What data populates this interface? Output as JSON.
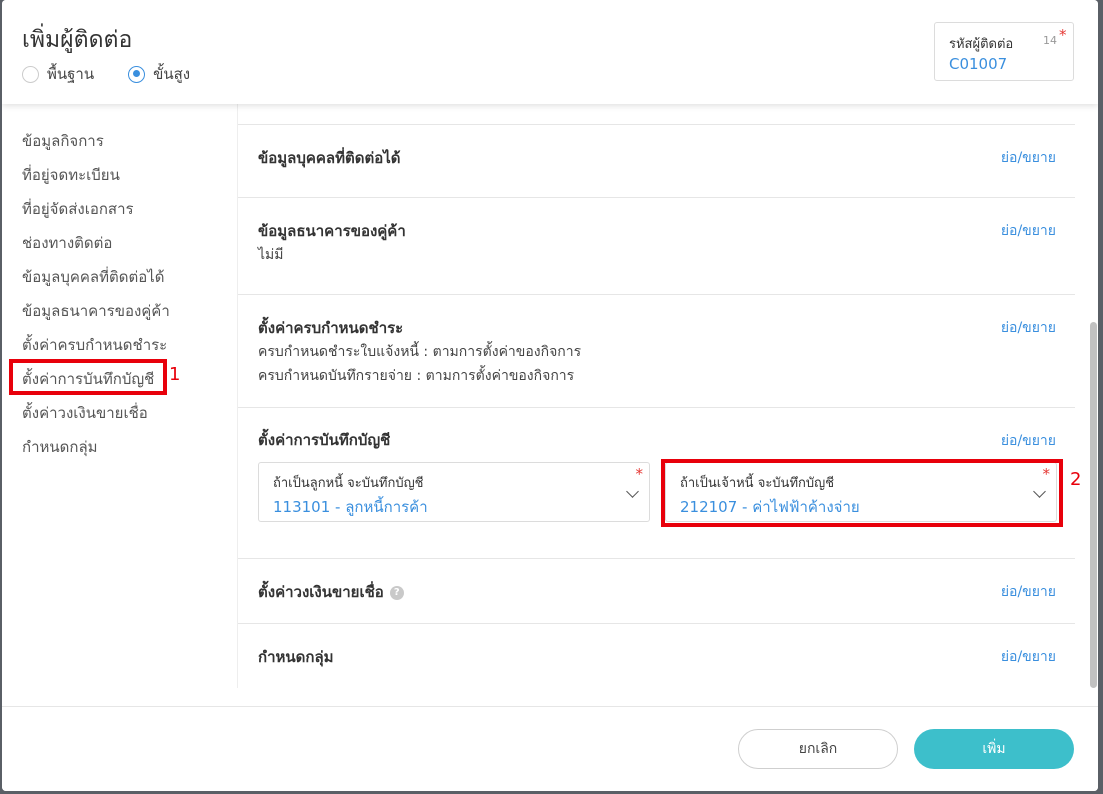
{
  "dialog": {
    "title": "เพิ่มผู้ติดต่อ",
    "mode_options": [
      {
        "label": "พื้นฐาน",
        "selected": false
      },
      {
        "label": "ขั้นสูง",
        "selected": true
      }
    ],
    "contact_code": {
      "label": "รหัสผู้ติดต่อ",
      "count": "14",
      "required_mark": "*",
      "value": "C01007"
    }
  },
  "sidebar": {
    "items": [
      {
        "label": "ข้อมูลกิจการ"
      },
      {
        "label": "ที่อยู่จดทะเบียน"
      },
      {
        "label": "ที่อยู่จัดส่งเอกสาร"
      },
      {
        "label": "ช่องทางติดต่อ"
      },
      {
        "label": "ข้อมูลบุคคลที่ติดต่อได้"
      },
      {
        "label": "ข้อมูลธนาคารของคู่ค้า"
      },
      {
        "label": "ตั้งค่าครบกำหนดชำระ"
      },
      {
        "label": "ตั้งค่าการบันทึกบัญชี"
      },
      {
        "label": "ตั้งค่าวงเงินขายเชื่อ"
      },
      {
        "label": "กำหนดกลุ่ม"
      }
    ]
  },
  "sections": {
    "toggle_label": "ย่อ/ขยาย",
    "contacts": {
      "title": "ข้อมูลบุคคลที่ติดต่อได้"
    },
    "bank": {
      "title": "ข้อมูลธนาคารของคู่ค้า",
      "value": "ไม่มี"
    },
    "due": {
      "title": "ตั้งค่าครบกำหนดชำระ",
      "line1": "ครบกำหนดชำระใบแจ้งหนี้ : ตามการตั้งค่าของกิจการ",
      "line2": "ครบกำหนดบันทึกรายจ่าย : ตามการตั้งค่าของกิจการ"
    },
    "accounting": {
      "title": "ตั้งค่าการบันทึกบัญชี",
      "debtor": {
        "label": "ถ้าเป็นลูกหนี้ จะบันทึกบัญชี",
        "value": "113101 - ลูกหนี้การค้า",
        "required_mark": "*"
      },
      "creditor": {
        "label": "ถ้าเป็นเจ้าหนี้ จะบันทึกบัญชี",
        "value": "212107 - ค่าไฟฟ้าค้างจ่าย",
        "required_mark": "*"
      }
    },
    "credit": {
      "title": "ตั้งค่าวงเงินขายเชื่อ",
      "help": "?"
    },
    "group": {
      "title": "กำหนดกลุ่ม"
    }
  },
  "footer": {
    "cancel_label": "ยกเลิก",
    "add_label": "เพิ่ม"
  },
  "annotations": {
    "first": "1",
    "second": "2"
  },
  "colors": {
    "accent": "#3a8fde",
    "primary_button": "#3dbfcb",
    "annotation": "#e8000b",
    "required": "#e53935"
  }
}
